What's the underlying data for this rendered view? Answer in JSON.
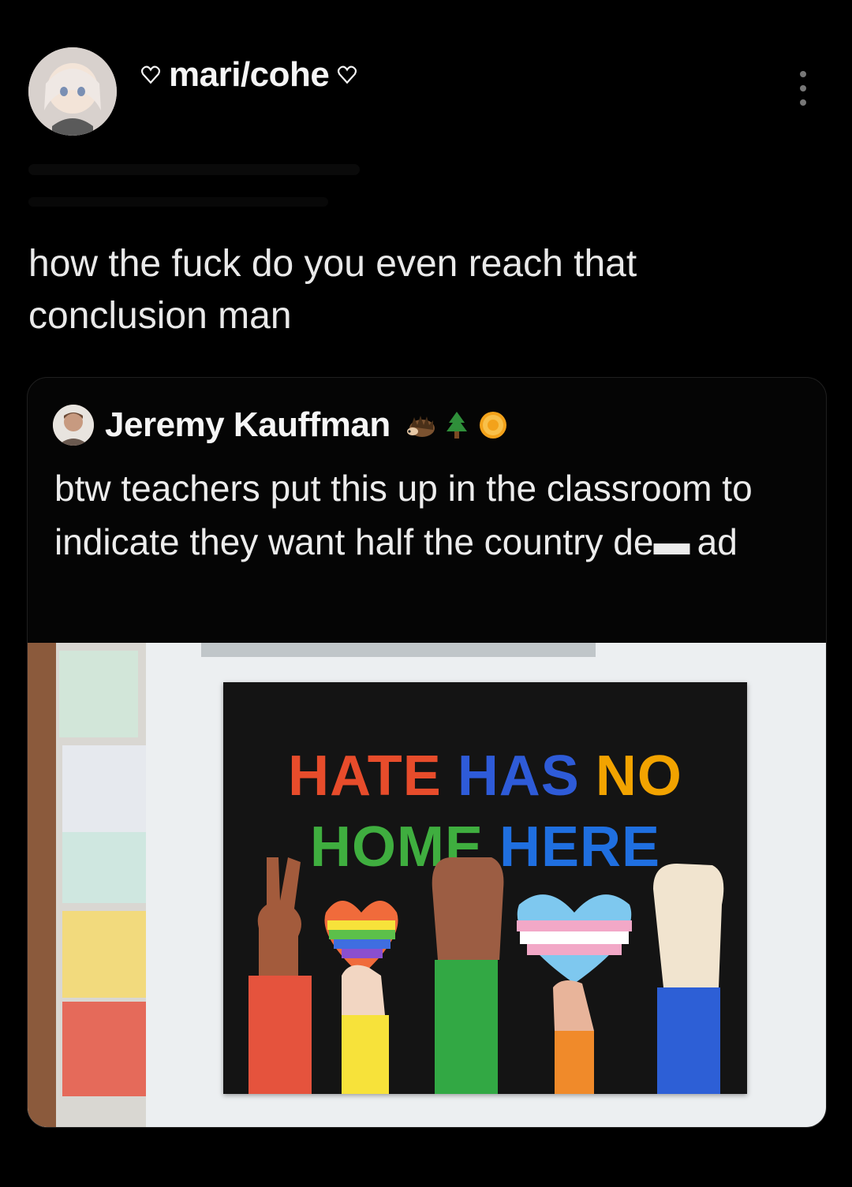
{
  "post": {
    "display_name": "mari/cohe",
    "text": "how the fuck do you even reach that conclusion man"
  },
  "quote": {
    "author": "Jeremy Kauffman",
    "author_emojis": [
      "hedgehog-icon",
      "evergreen-tree-icon",
      "bitcoin-coin-icon"
    ],
    "text": "btw teachers put this up in the classroom to indicate they want half the country de▬ ad"
  },
  "poster": {
    "words_line1": [
      {
        "text": "HATE",
        "color": "#e74c2b"
      },
      {
        "text": "HAS",
        "color": "#2e5bd8"
      },
      {
        "text": "NO",
        "color": "#f2a300"
      }
    ],
    "words_line2": [
      {
        "text": "HOME",
        "color": "#3fae3f"
      },
      {
        "text": "HERE",
        "color": "#1f6fe0"
      }
    ]
  },
  "colors": {
    "background": "#000000",
    "text": "#e9e9e9",
    "card_border": "#1f1f1f"
  }
}
